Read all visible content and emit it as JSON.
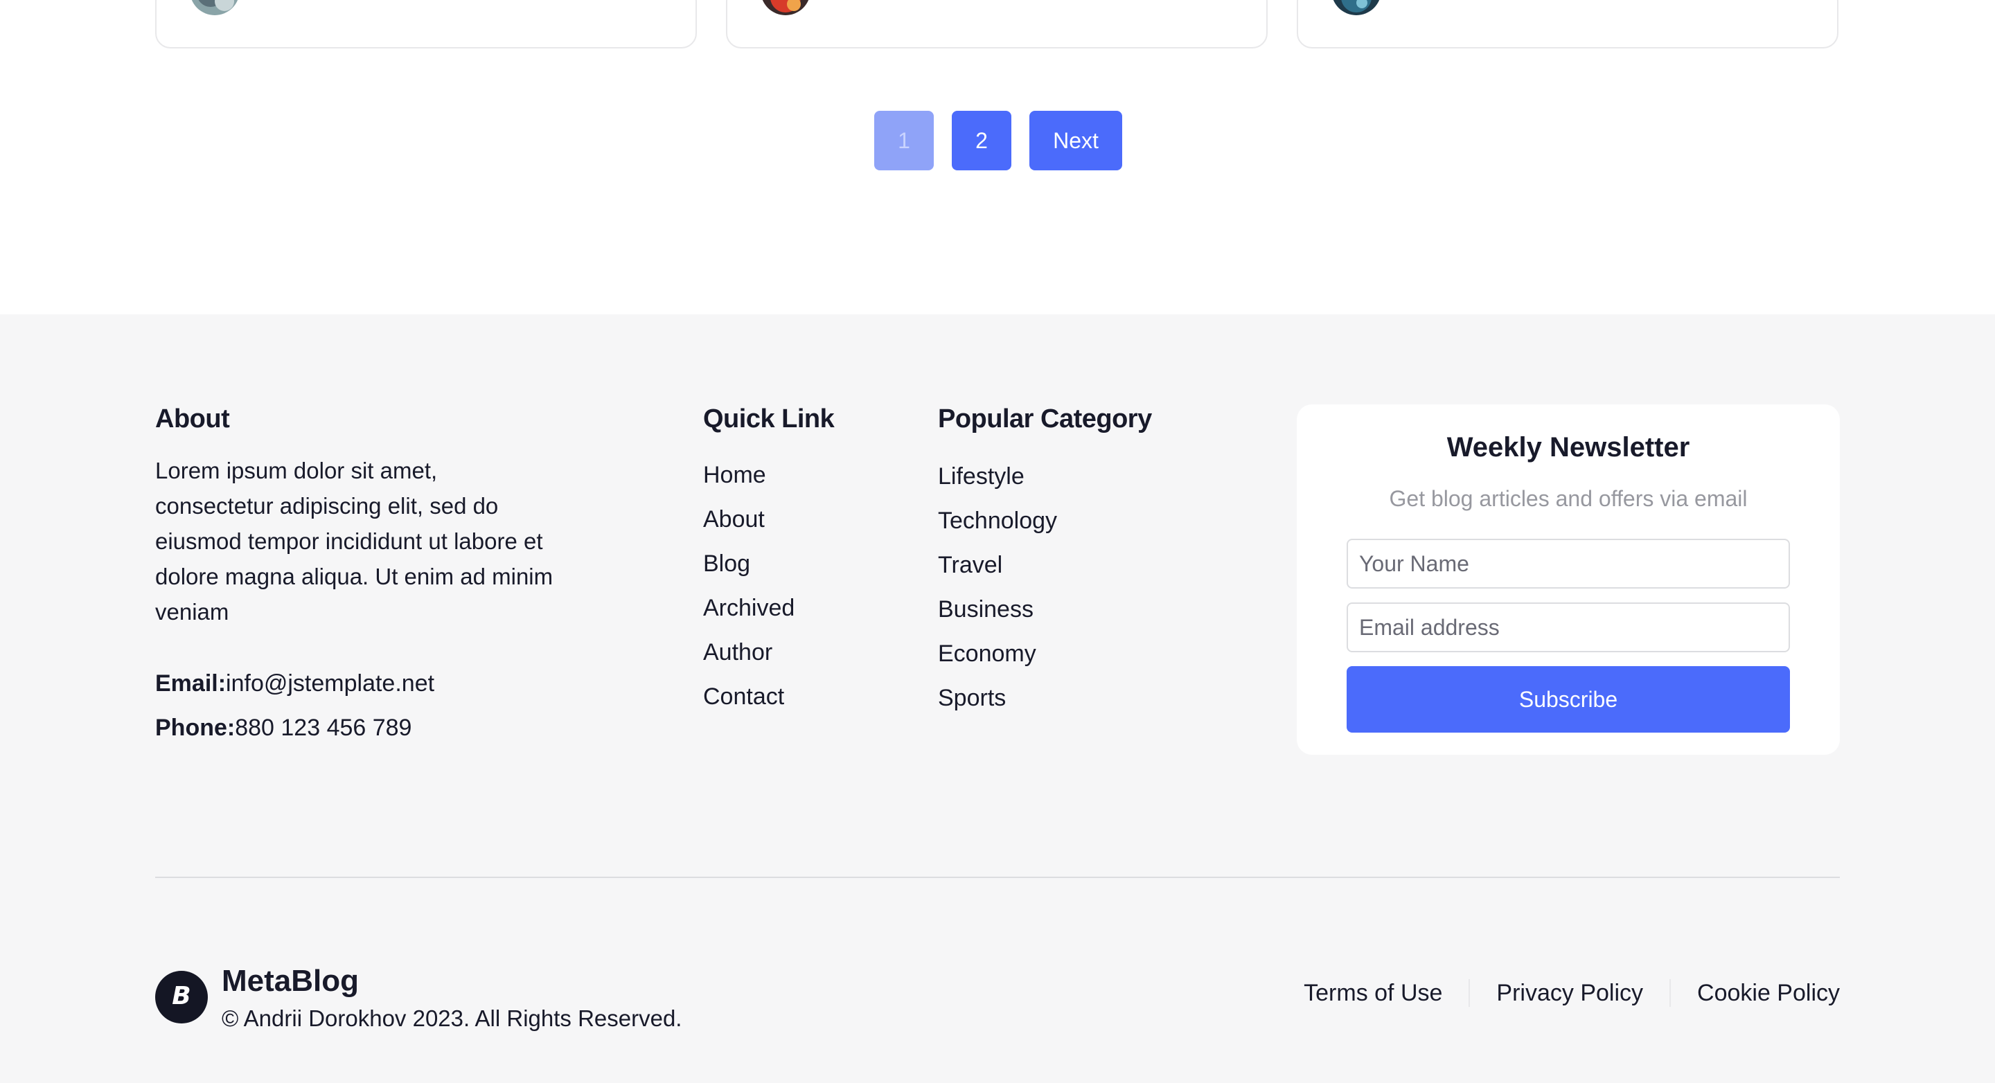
{
  "pagination": {
    "pages": [
      "1",
      "2"
    ],
    "current": "1",
    "next_label": "Next"
  },
  "footer": {
    "about": {
      "title": "About",
      "text": "Lorem ipsum dolor sit amet, consectetur adipiscing elit, sed do eiusmod tempor incididunt ut labore et dolore magna aliqua. Ut enim ad minim veniam",
      "email_label": "Email:",
      "email": "info@jstemplate.net",
      "phone_label": "Phone:",
      "phone": "880 123 456 789"
    },
    "quick_link": {
      "title": "Quick Link",
      "items": [
        "Home",
        "About",
        "Blog",
        "Archived",
        "Author",
        "Contact"
      ]
    },
    "popular_category": {
      "title": "Popular Category",
      "items": [
        "Lifestyle",
        "Technology",
        "Travel",
        "Business",
        "Economy",
        "Sports"
      ]
    },
    "newsletter": {
      "title": "Weekly Newsletter",
      "subtitle": "Get blog articles and offers via email",
      "name_placeholder": "Your Name",
      "email_placeholder": "Email address",
      "button_label": "Subscribe"
    },
    "brand": {
      "name_prefix": "Meta",
      "name_suffix": "Blog",
      "copyright": "© Andrii Dorokhov 2023. All Rights Reserved."
    },
    "legal_links": [
      "Terms of Use",
      "Privacy Policy",
      "Cookie Policy"
    ]
  },
  "colors": {
    "accent": "#4b6bfb",
    "accent_inactive": "#8fa3f8",
    "footer_bg": "#f6f6f7",
    "text": "#181a2a"
  }
}
